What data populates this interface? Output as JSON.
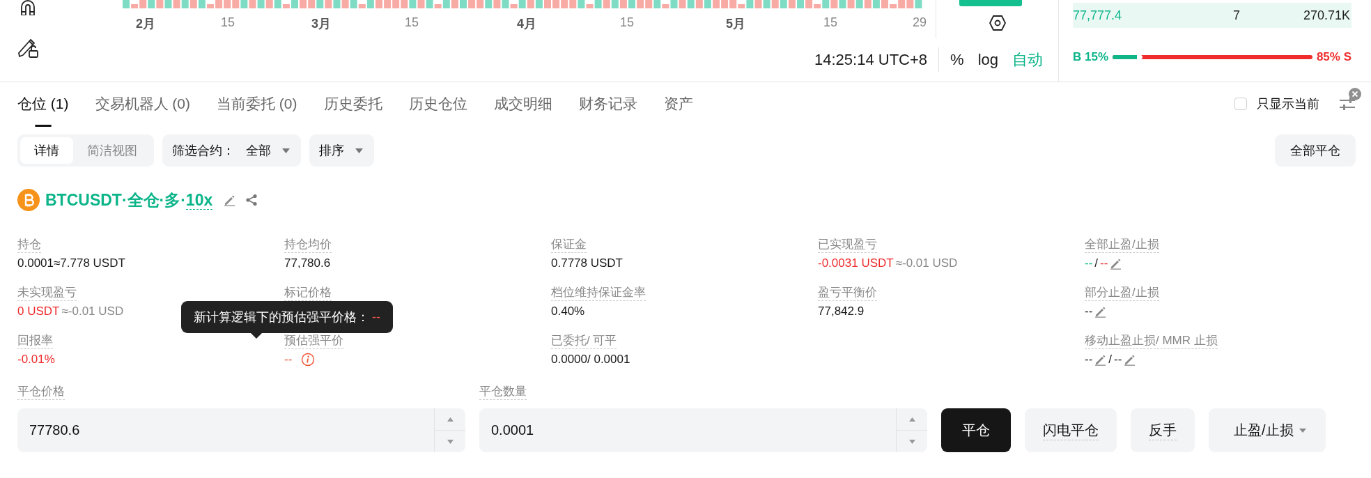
{
  "chart": {
    "x_axis": [
      {
        "label": "2月",
        "kind": "month"
      },
      {
        "label": "15",
        "kind": "day"
      },
      {
        "label": "3月",
        "kind": "month"
      },
      {
        "label": "15",
        "kind": "day"
      },
      {
        "label": "4月",
        "kind": "month"
      },
      {
        "label": "15",
        "kind": "day"
      },
      {
        "label": "5月",
        "kind": "month"
      },
      {
        "label": "15",
        "kind": "day"
      },
      {
        "label": "29",
        "kind": "day"
      }
    ],
    "time": "14:25:14 UTC+8",
    "scale_options": [
      {
        "label": "%",
        "selected": false
      },
      {
        "label": "log",
        "selected": false
      },
      {
        "label": "自动",
        "selected": true
      }
    ]
  },
  "order_book": {
    "row": {
      "price": "77,777.4",
      "quantity": "7",
      "total": "270.71K"
    },
    "buy_label": "B 15%",
    "sell_label": "85% S",
    "level": 0.15
  },
  "tabs": [
    {
      "label": "仓位 (1)",
      "selected": true
    },
    {
      "label": "交易机器人 (0)",
      "selected": false
    },
    {
      "label": "当前委托 (0)",
      "selected": false
    },
    {
      "label": "历史委托",
      "selected": false
    },
    {
      "label": "历史仓位",
      "selected": false
    },
    {
      "label": "成交明细",
      "selected": false
    },
    {
      "label": "财务记录",
      "selected": false
    },
    {
      "label": "资产",
      "selected": false
    }
  ],
  "only_current": {
    "label": "只显示当前",
    "checked": false
  },
  "views": [
    {
      "label": "详情",
      "selected": true
    },
    {
      "label": "简洁视图",
      "selected": false
    }
  ],
  "filter": {
    "label": "筛选合约：",
    "value": "全部"
  },
  "sort": {
    "label": "排序"
  },
  "close_all": {
    "label": "全部平仓"
  },
  "position": {
    "symbol": "BTCUSDT·全仓·多·",
    "leverage": "10x",
    "columns": [
      [
        {
          "label": "持仓",
          "value": [
            {
              "kind": "text",
              "text": "0.0001≈7.778 USDT",
              "color": "#1a1a1a"
            }
          ]
        },
        {
          "label": "未实现盈亏",
          "value": [
            {
              "kind": "text",
              "text": "0 USDT",
              "color": "#ef2b2b"
            },
            {
              "kind": "text",
              "text": "≈-0.01 USD",
              "color": "#888888"
            }
          ]
        },
        {
          "label": "回报率",
          "value": [
            {
              "kind": "text",
              "text": "-0.01%",
              "color": "#ef2b2b"
            }
          ]
        }
      ],
      [
        {
          "label": "持仓均价",
          "value": [
            {
              "kind": "text",
              "text": "77,780.6",
              "color": "#1a1a1a"
            }
          ]
        },
        {
          "label": "标记价格"
        },
        {
          "label": "预估强平价",
          "value": [
            {
              "kind": "text",
              "text": "--",
              "color": "#f0502f"
            },
            {
              "kind": "info"
            }
          ]
        }
      ],
      [
        {
          "label": "保证金",
          "value": [
            {
              "kind": "text",
              "text": "0.7778 USDT",
              "color": "#1a1a1a"
            }
          ]
        },
        {
          "label": "档位维持保证金率",
          "value": [
            {
              "kind": "text",
              "text": "0.40%",
              "color": "#1a1a1a"
            }
          ]
        },
        {
          "label": "已委托/ 可平",
          "value": [
            {
              "kind": "text",
              "text": "0.0000/ 0.0001",
              "color": "#1a1a1a"
            }
          ]
        }
      ],
      [
        {
          "label": "已实现盈亏",
          "value": [
            {
              "kind": "text",
              "text": "-0.0031 USDT",
              "color": "#ef2b2b"
            },
            {
              "kind": "text",
              "text": "≈-0.01 USD",
              "color": "#888888"
            }
          ]
        },
        {
          "label": "盈亏平衡价",
          "value": [
            {
              "kind": "text",
              "text": "77,842.9",
              "color": "#1a1a1a"
            }
          ]
        }
      ],
      [
        {
          "label": "全部止盈/止损",
          "value": [
            {
              "kind": "text",
              "text": "--",
              "color": "#0bb489"
            },
            {
              "kind": "text",
              "text": "/",
              "color": "#1a1a1a"
            },
            {
              "kind": "text",
              "text": "--",
              "color": "#ef2b2b"
            },
            {
              "kind": "edit"
            }
          ]
        },
        {
          "label": "部分止盈/止损",
          "value": [
            {
              "kind": "text",
              "text": "--",
              "color": "#1a1a1a"
            },
            {
              "kind": "edit"
            }
          ]
        },
        {
          "label": "移动止盈止损/ MMR 止损",
          "value": [
            {
              "kind": "text",
              "text": "--",
              "color": "#1a1a1a"
            },
            {
              "kind": "edit"
            },
            {
              "kind": "text",
              "text": "/",
              "color": "#1a1a1a"
            },
            {
              "kind": "text",
              "text": "--",
              "color": "#1a1a1a"
            },
            {
              "kind": "edit"
            }
          ]
        }
      ]
    ]
  },
  "tooltip": {
    "text": "新计算逻辑下的预估强平价格：",
    "value": "--"
  },
  "close_form": {
    "price": {
      "label": "平仓价格",
      "value": "77780.6"
    },
    "quantity": {
      "label": "平仓数量",
      "value": "0.0001"
    },
    "buttons": [
      {
        "label": "平仓",
        "kind": "primary"
      },
      {
        "label": "闪电平仓",
        "kind": "secondary"
      },
      {
        "label": "反手",
        "kind": "secondary"
      },
      {
        "label": "止盈/止损",
        "kind": "dropdown"
      }
    ]
  }
}
